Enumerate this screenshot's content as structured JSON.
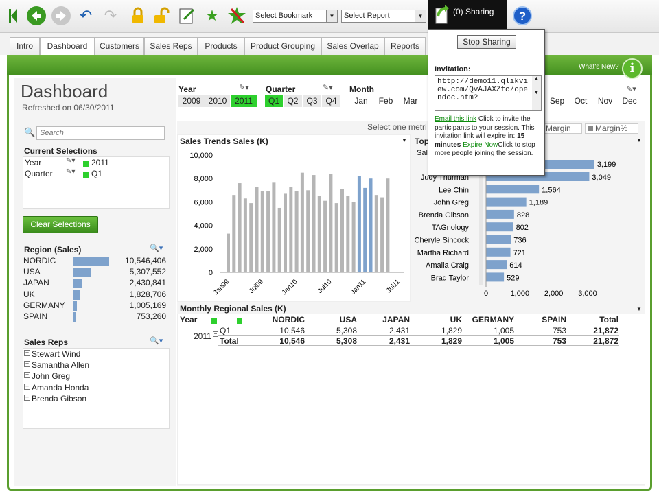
{
  "toolbar": {
    "bookmark_select": "Select Bookmark",
    "report_select": "Select Report",
    "sharing_label": "(0) Sharing"
  },
  "tabs": [
    "Intro",
    "Dashboard",
    "Customers",
    "Sales Reps",
    "Products",
    "Product Grouping",
    "Sales Overlap",
    "Reports"
  ],
  "header": {
    "whats_new": "What's New?",
    "title": "Dashboard",
    "refreshed": "Refreshed on 06/30/2011"
  },
  "filters": {
    "year_label": "Year",
    "years": [
      "2009",
      "2010",
      "2011"
    ],
    "quarter_label": "Quarter",
    "quarters": [
      "Q1",
      "Q2",
      "Q3",
      "Q4"
    ],
    "month_label": "Month",
    "months_left": [
      "Jan",
      "Feb",
      "Mar"
    ],
    "months_right": [
      "Sep",
      "Oct",
      "Nov",
      "Dec"
    ]
  },
  "left": {
    "search_placeholder": "Search",
    "current_selections_title": "Current Selections",
    "selections": [
      {
        "field": "Year",
        "value": "2011"
      },
      {
        "field": "Quarter",
        "value": "Q1"
      }
    ],
    "clear_button": "Clear Selections",
    "region_title": "Region (Sales)",
    "regions": [
      {
        "name": "NORDIC",
        "value": "10,546,406",
        "num": 10546406
      },
      {
        "name": "USA",
        "value": "5,307,552",
        "num": 5307552
      },
      {
        "name": "JAPAN",
        "value": "2,430,841",
        "num": 2430841
      },
      {
        "name": "UK",
        "value": "1,828,706",
        "num": 1828706
      },
      {
        "name": "GERMANY",
        "value": "1,005,169",
        "num": 1005169
      },
      {
        "name": "SPAIN",
        "value": "753,260",
        "num": 753260
      }
    ],
    "sales_reps_title": "Sales Reps",
    "sales_reps": [
      "Stewart Wind",
      "Samantha Allen",
      "John Greg",
      "Amanda Honda",
      "Brenda Gibson"
    ]
  },
  "metrics_bar": {
    "label": "Select one metri",
    "margin": "Margin",
    "margin_pct": "Margin%"
  },
  "popup": {
    "stop_button": "Stop Sharing",
    "invitation_label": "Invitation:",
    "url": "http://demo11.qlikview.com/QvAJAXZfc/opendoc.htm?",
    "email_link": "Email this link",
    "text1": "Click to invite the participants to your session. This invitation link will expire in:",
    "expire_time": "15 minutes",
    "expire_link": "Expire Now",
    "text2": "Click to stop more people joining the session."
  },
  "sales_trend": {
    "title": "Sales Trends Sales (K)"
  },
  "top_reps": {
    "title": "Top",
    "sub": "Sal"
  },
  "monthly": {
    "title": "Monthly Regional Sales (K)",
    "columns": [
      "Year",
      "NORDIC",
      "USA",
      "JAPAN",
      "UK",
      "GERMANY",
      "SPAIN",
      "Total"
    ],
    "row_year": "2011",
    "row_q": "Q1",
    "row_q_values": [
      "10,546",
      "5,308",
      "2,431",
      "1,829",
      "1,005",
      "753",
      "21,872"
    ],
    "total_label": "Total",
    "total_values": [
      "10,546",
      "5,308",
      "2,431",
      "1,829",
      "1,005",
      "753",
      "21,872"
    ]
  },
  "chart_data": [
    {
      "type": "bar",
      "title": "Sales Trends Sales (K)",
      "ylim": [
        0,
        10000
      ],
      "yticks": [
        "10,000",
        "8,000",
        "6,000",
        "4,000",
        "2,000",
        "0"
      ],
      "xticks": [
        "Jan09",
        "Jul09",
        "Jan10",
        "Jul10",
        "Jan11",
        "Jul11"
      ],
      "values": [
        3300,
        6600,
        7600,
        6300,
        5900,
        7300,
        6900,
        6900,
        7700,
        5500,
        6700,
        7300,
        6900,
        8500,
        7000,
        8300,
        6500,
        6100,
        8400,
        5900,
        7100,
        6500,
        6000,
        8200,
        7200,
        8000,
        6600,
        6400,
        8000
      ],
      "highlight": [
        23,
        24,
        25
      ]
    },
    {
      "type": "bar",
      "orientation": "horizontal",
      "categories": [
        "Judy Thurman",
        "Lee Chin",
        "John Greg",
        "Brenda Gibson",
        "TAGnology",
        "Cheryle Sincock",
        "Martha Richard",
        "Amalia Craig",
        "Brad Taylor"
      ],
      "first_value": 3199,
      "values": [
        3049,
        1564,
        1189,
        828,
        802,
        736,
        721,
        614,
        529
      ],
      "labels": [
        "3,049",
        "1,564",
        "1,189",
        "828",
        "802",
        "736",
        "721",
        "614",
        "529"
      ],
      "first_label": "3,199",
      "xticks": [
        "0",
        "1,000",
        "2,000",
        "3,000"
      ],
      "xlim": [
        0,
        3500
      ]
    }
  ]
}
